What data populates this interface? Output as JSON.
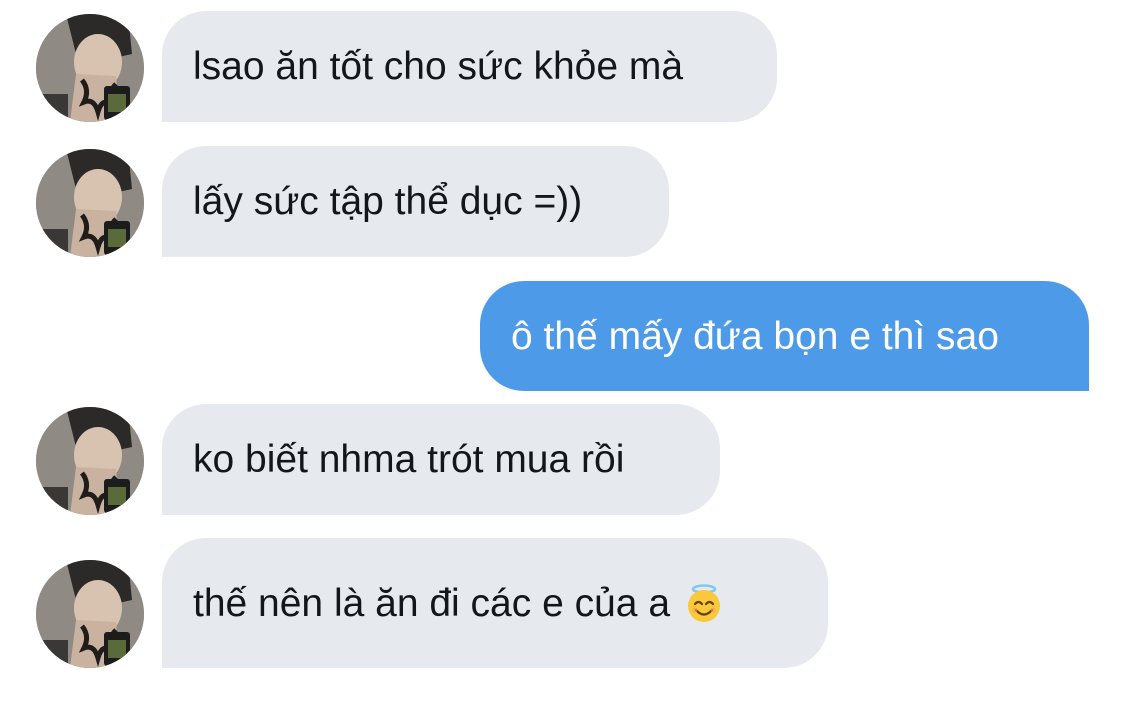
{
  "conversation": {
    "messages": [
      {
        "direction": "incoming",
        "text": "lsao ăn tốt cho sức khỏe mà",
        "avatar": "user-avatar"
      },
      {
        "direction": "incoming",
        "text": "lấy sức tập thể dục =))",
        "avatar": "user-avatar"
      },
      {
        "direction": "outgoing",
        "text": "ô thế mấy đứa bọn e thì sao"
      },
      {
        "direction": "incoming",
        "text": "ko biết nhma trót mua rồi",
        "avatar": "user-avatar"
      },
      {
        "direction": "incoming",
        "text": "thế nên là ăn đi các e của a",
        "emoji": "smiling-face-with-halo-icon",
        "avatar": "user-avatar"
      }
    ]
  },
  "colors": {
    "incoming_bubble": "#e6eaee",
    "outgoing_bubble": "#4d9be8",
    "incoming_text": "#14171a",
    "outgoing_text": "#ffffff"
  }
}
